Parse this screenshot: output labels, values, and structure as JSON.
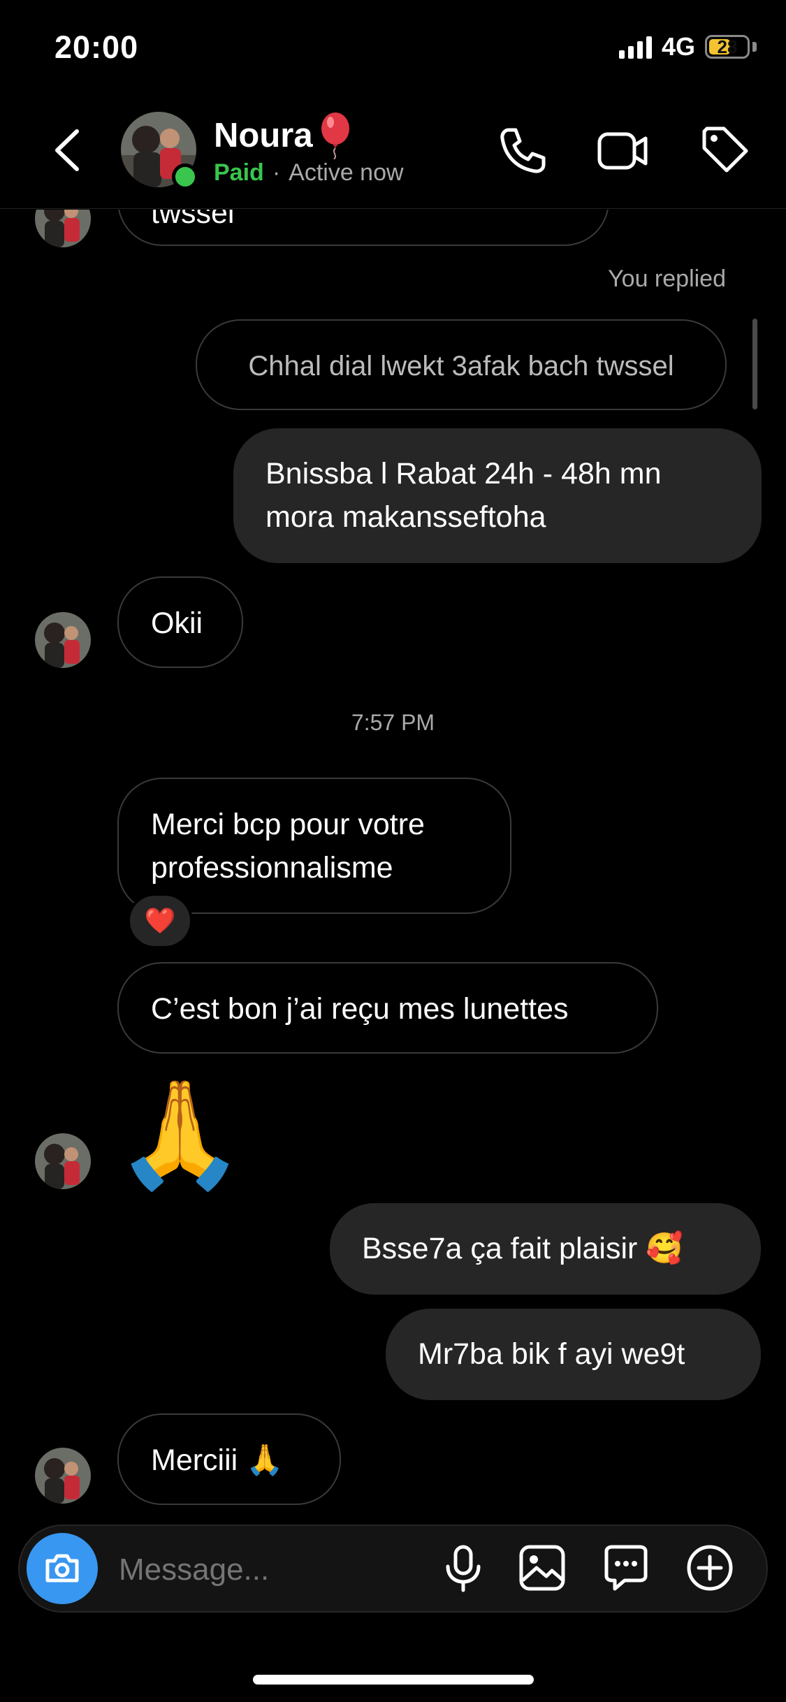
{
  "status_bar": {
    "time": "20:00",
    "network": "4G",
    "battery": "28"
  },
  "header": {
    "name": "Noura",
    "paid_label": "Paid",
    "separator": "·",
    "presence": "Active now"
  },
  "thread": {
    "partial_text": "twssel",
    "you_replied": "You replied",
    "replied_to": "Chhal dial lwekt 3afak bach twssel",
    "outgoing_1": "Bnissba l Rabat 24h - 48h mn mora makansseftoha",
    "incoming_1": "Okii",
    "timestamp": "7:57 PM",
    "incoming_2": "Merci bcp pour votre professionnalisme",
    "reaction_2": "❤️",
    "incoming_3": "C’est bon j’ai reçu mes lunettes",
    "incoming_4_emoji": "🙏",
    "outgoing_2": "Bsse7a ça fait plaisir",
    "outgoing_2_emoji": "🥰",
    "outgoing_3": "Mr7ba bik f ayi we9t",
    "incoming_5": "Merciii",
    "incoming_5_emoji": "🙏"
  },
  "composer": {
    "placeholder": "Message..."
  },
  "icons": [
    "back-chevron-icon",
    "phone-icon",
    "video-icon",
    "tag-icon",
    "balloon-icon",
    "camera-icon",
    "microphone-icon",
    "gallery-icon",
    "sticker-icon",
    "plus-icon",
    "heart-icon",
    "pray-emoji",
    "smiling-hearts-emoji"
  ],
  "colors": {
    "accent_green": "#39c54e",
    "camera_blue": "#3897f0",
    "outgoing_bubble": "#262626",
    "battery_fill": "#f4c430"
  }
}
